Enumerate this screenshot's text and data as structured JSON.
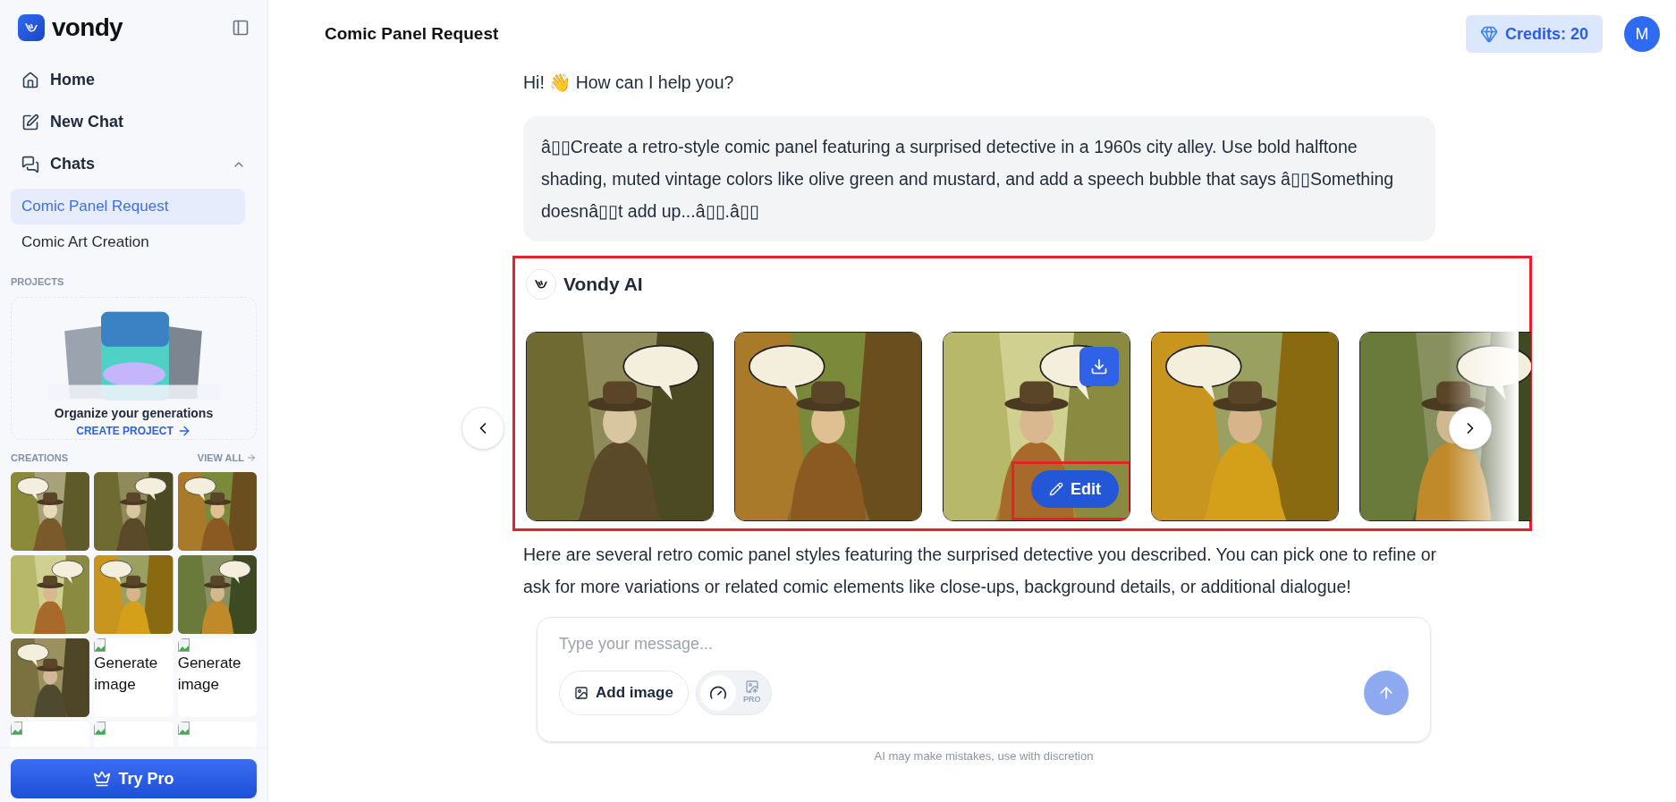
{
  "sidebar": {
    "brand": "vondy",
    "nav": [
      {
        "kind": "home",
        "label": "Home"
      },
      {
        "kind": "new_chat",
        "label": "New Chat"
      },
      {
        "kind": "chats",
        "label": "Chats",
        "expanded": true
      }
    ],
    "chats": [
      {
        "label": "Comic Panel Request",
        "selected": true
      },
      {
        "label": "Comic Art Creation",
        "selected": false
      }
    ],
    "projects": {
      "heading": "PROJECTS",
      "prompt": "Organize your generations",
      "action": "CREATE PROJECT"
    },
    "creations": {
      "heading": "CREATIONS",
      "view_all": "VIEW ALL",
      "items": [
        {
          "kind": "picture"
        },
        {
          "kind": "picture"
        },
        {
          "kind": "picture"
        },
        {
          "kind": "picture"
        },
        {
          "kind": "picture"
        },
        {
          "kind": "picture"
        },
        {
          "kind": "picture"
        },
        {
          "kind": "broken",
          "alt": [
            "Generate",
            "image"
          ]
        },
        {
          "kind": "broken",
          "alt": [
            "Generate",
            "image"
          ]
        },
        {
          "kind": "broken"
        },
        {
          "kind": "broken"
        },
        {
          "kind": "broken"
        }
      ]
    },
    "upgrade_button": "Try Pro"
  },
  "header": {
    "title": "Comic Panel Request",
    "credits": "Credits: 20",
    "avatar": "M"
  },
  "messages": [
    {
      "kind": "assistant_text",
      "text": "Hi! 👋 How can I help you?"
    },
    {
      "kind": "user",
      "text": "â▯▯Create a retro-style comic panel featuring a surprised detective in a 1960s city alley. Use bold halftone shading, muted vintage colors like olive green and mustard, and add a speech bubble that says â▯▯Something doesnâ▯▯t add up...â▯▯.â▯▯"
    },
    {
      "kind": "assistant_images",
      "sender": "Vondy AI",
      "highlighted": true,
      "images": [
        {
          "kind": "picture",
          "hovered": false
        },
        {
          "kind": "picture",
          "hovered": false
        },
        {
          "kind": "picture",
          "hovered": true,
          "edit_label": "Edit",
          "edit_highlighted": true
        },
        {
          "kind": "picture",
          "hovered": false
        },
        {
          "kind": "picture",
          "hovered": false
        }
      ]
    },
    {
      "kind": "assistant_text",
      "text": "Here are several retro comic panel styles featuring the surprised detective you described. You can pick one to refine or ask for more variations or related comic elements like close-ups, background details, or additional dialogue!"
    }
  ],
  "composer": {
    "placeholder": "Type your message...",
    "add_image": "Add image",
    "pro_badge": "PRO"
  },
  "disclaimer": "AI may make mistakes, use with discretion"
}
